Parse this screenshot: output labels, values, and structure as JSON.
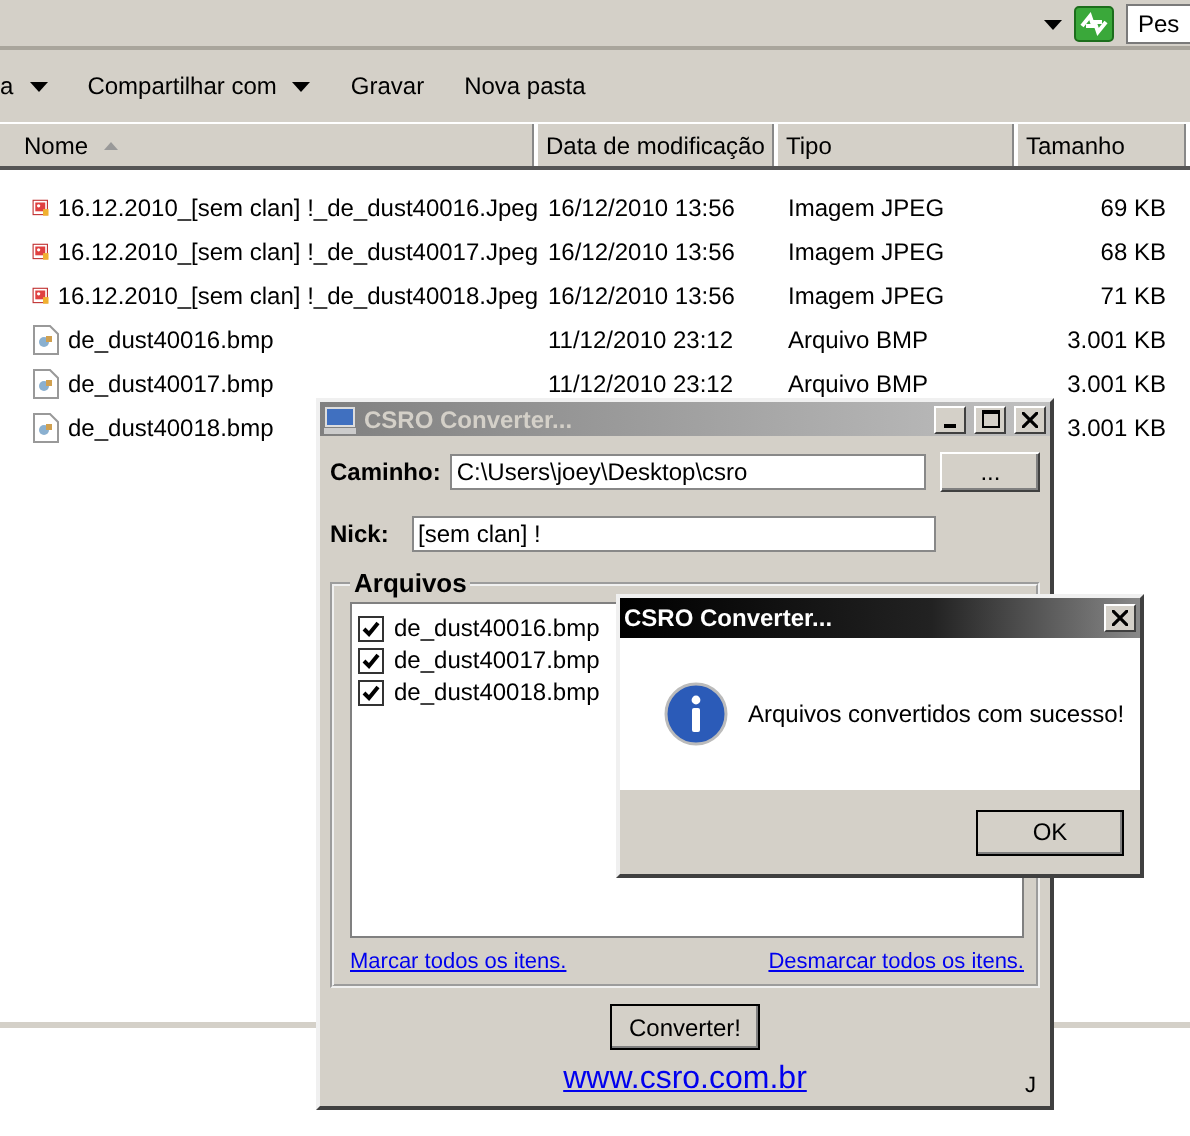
{
  "explorer": {
    "search": {
      "placeholder": "Pes"
    },
    "toolbar": [
      {
        "label": "a",
        "dropdown": true
      },
      {
        "label": "Compartilhar com",
        "dropdown": true
      },
      {
        "label": "Gravar",
        "dropdown": false
      },
      {
        "label": "Nova pasta",
        "dropdown": false
      }
    ],
    "columns": [
      {
        "label": "Nome",
        "sorted": true
      },
      {
        "label": "Data de modificação",
        "sorted": false
      },
      {
        "label": "Tipo",
        "sorted": false
      },
      {
        "label": "Tamanho",
        "sorted": false
      }
    ],
    "files": [
      {
        "kind": "jpeg",
        "name": "16.12.2010_[sem clan] !_de_dust40016.Jpeg",
        "modified": "16/12/2010 13:56",
        "type": "Imagem JPEG",
        "size": "69 KB"
      },
      {
        "kind": "jpeg",
        "name": "16.12.2010_[sem clan] !_de_dust40017.Jpeg",
        "modified": "16/12/2010 13:56",
        "type": "Imagem JPEG",
        "size": "68 KB"
      },
      {
        "kind": "jpeg",
        "name": "16.12.2010_[sem clan] !_de_dust40018.Jpeg",
        "modified": "16/12/2010 13:56",
        "type": "Imagem JPEG",
        "size": "71 KB"
      },
      {
        "kind": "bmp",
        "name": "de_dust40016.bmp",
        "modified": "11/12/2010 23:12",
        "type": "Arquivo BMP",
        "size": "3.001 KB"
      },
      {
        "kind": "bmp",
        "name": "de_dust40017.bmp",
        "modified": "11/12/2010 23:12",
        "type": "Arquivo BMP",
        "size": "3.001 KB"
      },
      {
        "kind": "bmp",
        "name": "de_dust40018.bmp",
        "size": "3.001 KB"
      }
    ]
  },
  "converter": {
    "title": "CSRO Converter...",
    "path_label": "Caminho:",
    "path": "C:\\Users\\joey\\Desktop\\csro",
    "browse": "...",
    "nick_label": "Nick:",
    "nick": "[sem clan] !",
    "group": "Arquivos",
    "files": [
      {
        "name": "de_dust40016.bmp",
        "checked": true
      },
      {
        "name": "de_dust40017.bmp",
        "checked": true
      },
      {
        "name": "de_dust40018.bmp",
        "checked": true
      }
    ],
    "select_all": "Marcar todos os itens.",
    "deselect_all": "Desmarcar todos os itens.",
    "convert": "Converter!",
    "website": "www.csro.com.br",
    "corner": "J"
  },
  "message_box": {
    "title": "CSRO Converter...",
    "message": "Arquivos convertidos com sucesso!",
    "ok": "OK"
  }
}
